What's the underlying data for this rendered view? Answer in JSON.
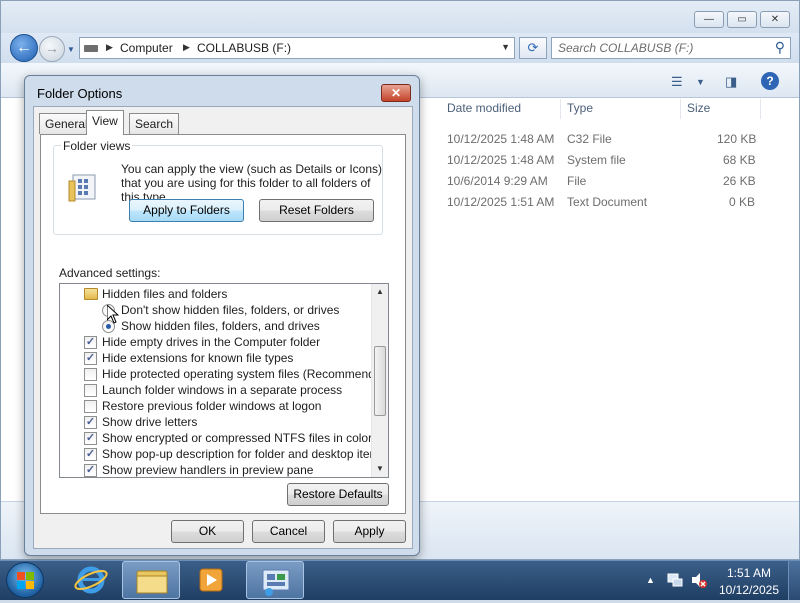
{
  "explorer": {
    "address": {
      "segments": [
        "Computer",
        "COLLABUSB (F:)"
      ]
    },
    "search": {
      "placeholder": "Search COLLABUSB (F:)"
    },
    "columns": [
      "Date modified",
      "Type",
      "Size"
    ],
    "files": [
      {
        "date": "10/12/2025 1:48 AM",
        "type": "C32 File",
        "size": "120 KB"
      },
      {
        "date": "10/12/2025 1:48 AM",
        "type": "System file",
        "size": "68 KB"
      },
      {
        "date": "10/6/2014 9:29 AM",
        "type": "File",
        "size": "26 KB"
      },
      {
        "date": "10/12/2025 1:51 AM",
        "type": "Text Document",
        "size": "0 KB"
      }
    ]
  },
  "dialog": {
    "title": "Folder Options",
    "close_icon": "close-icon",
    "tabs": [
      "General",
      "View",
      "Search"
    ],
    "selected_tab": "View",
    "folder_views": {
      "label": "Folder views",
      "text": "You can apply the view (such as Details or Icons) that you are using for this folder to all folders of this type.",
      "apply_button": "Apply to Folders",
      "reset_button": "Reset Folders"
    },
    "advanced": {
      "label": "Advanced settings:",
      "items": [
        {
          "kind": "folder",
          "label": "Hidden files and folders"
        },
        {
          "kind": "radio",
          "label": "Don't show hidden files, folders, or drives",
          "checked": false
        },
        {
          "kind": "radio",
          "label": "Show hidden files, folders, and drives",
          "checked": true
        },
        {
          "kind": "checkbox",
          "label": "Hide empty drives in the Computer folder",
          "checked": true
        },
        {
          "kind": "checkbox",
          "label": "Hide extensions for known file types",
          "checked": true
        },
        {
          "kind": "checkbox",
          "label": "Hide protected operating system files (Recommended)",
          "checked": false
        },
        {
          "kind": "checkbox",
          "label": "Launch folder windows in a separate process",
          "checked": false
        },
        {
          "kind": "checkbox",
          "label": "Restore previous folder windows at logon",
          "checked": false
        },
        {
          "kind": "checkbox",
          "label": "Show drive letters",
          "checked": true
        },
        {
          "kind": "checkbox",
          "label": "Show encrypted or compressed NTFS files in color",
          "checked": true
        },
        {
          "kind": "checkbox",
          "label": "Show pop-up description for folder and desktop items",
          "checked": true
        },
        {
          "kind": "checkbox",
          "label": "Show preview handlers in preview pane",
          "checked": true
        }
      ]
    },
    "restore_defaults": "Restore Defaults",
    "ok": "OK",
    "cancel": "Cancel",
    "apply": "Apply"
  },
  "taskbar": {
    "time": "1:51 AM",
    "date": "10/12/2025"
  }
}
